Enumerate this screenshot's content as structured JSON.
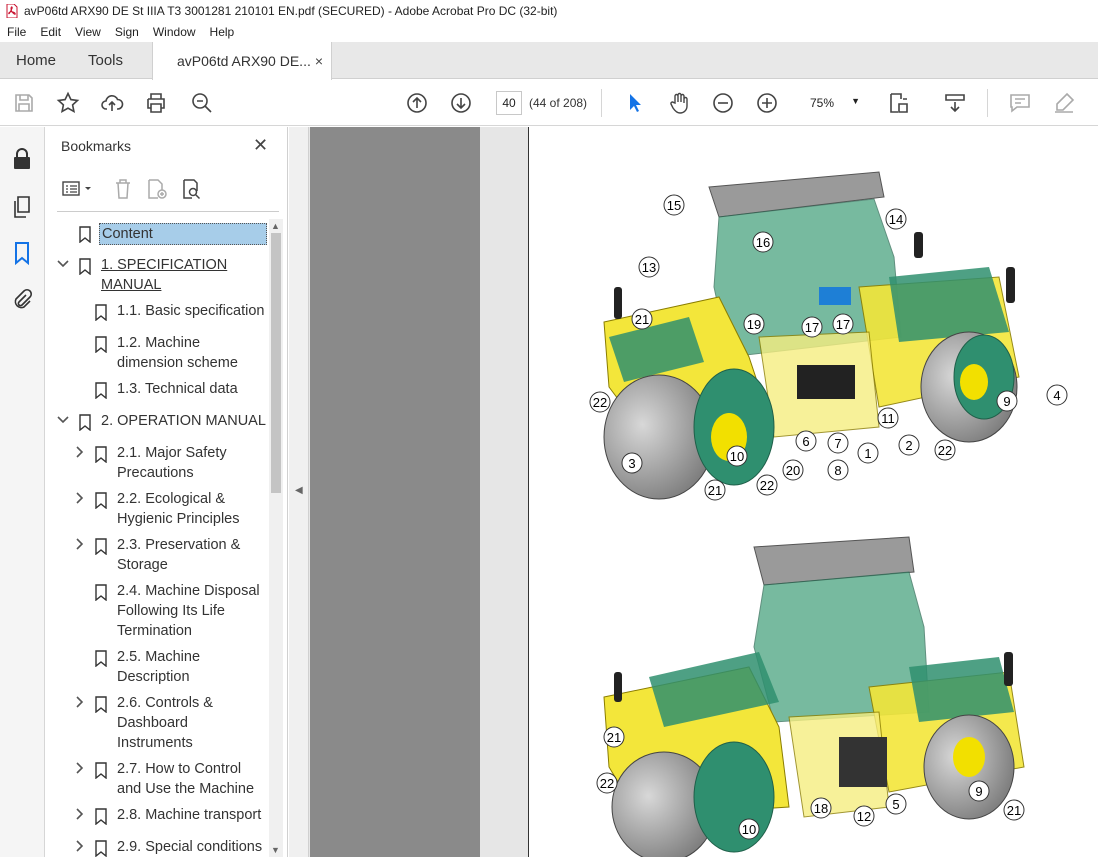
{
  "window": {
    "title": "avP06td ARX90 DE St IIIA T3 3001281 210101 EN.pdf (SECURED) - Adobe Acrobat Pro DC (32-bit)"
  },
  "menu": [
    "File",
    "Edit",
    "View",
    "Sign",
    "Window",
    "Help"
  ],
  "tabs": {
    "home": "Home",
    "tools": "Tools",
    "doc": "avP06td ARX90 DE...",
    "close": "×"
  },
  "toolbar": {
    "page_value": "40",
    "page_count": "(44 of 208)",
    "zoom": "75%"
  },
  "bookmarks": {
    "title": "Bookmarks",
    "close": "✕",
    "items": [
      {
        "label": "Content",
        "selected": true
      },
      {
        "label": "1. SPECIFICATION\nMANUAL"
      },
      {
        "label": "1.1. Basic specification"
      },
      {
        "label": "1.2. Machine\ndimension scheme"
      },
      {
        "label": "1.3. Technical data"
      },
      {
        "label": "2. OPERATION MANUAL"
      },
      {
        "label": "2.1. Major Safety\nPrecautions"
      },
      {
        "label": "2.2. Ecological &\nHygienic Principles"
      },
      {
        "label": "2.3. Preservation &\nStorage"
      },
      {
        "label": "2.4. Machine Disposal\nFollowing Its Life\nTermination"
      },
      {
        "label": "2.5. Machine\nDescription"
      },
      {
        "label": "2.6. Controls &\nDashboard\nInstruments"
      },
      {
        "label": "2.7. How to Control\nand Use the Machine"
      },
      {
        "label": "2.8. Machine transport"
      },
      {
        "label": "2.9. Special conditions"
      }
    ]
  },
  "figure": {
    "callouts_top": [
      "15",
      "14",
      "16",
      "13",
      "21",
      "19",
      "17",
      "17",
      "22",
      "11",
      "9",
      "4",
      "6",
      "7",
      "1",
      "2",
      "22",
      "3",
      "10",
      "8",
      "20",
      "22",
      "21"
    ],
    "callouts_bottom": [
      "21",
      "22",
      "18",
      "12",
      "5",
      "9",
      "21",
      "10"
    ]
  },
  "colors": {
    "accent": "#1473e6",
    "selection": "#a7cde9",
    "machine_green": "#2f8f6f",
    "machine_yellow": "#f2e000"
  }
}
